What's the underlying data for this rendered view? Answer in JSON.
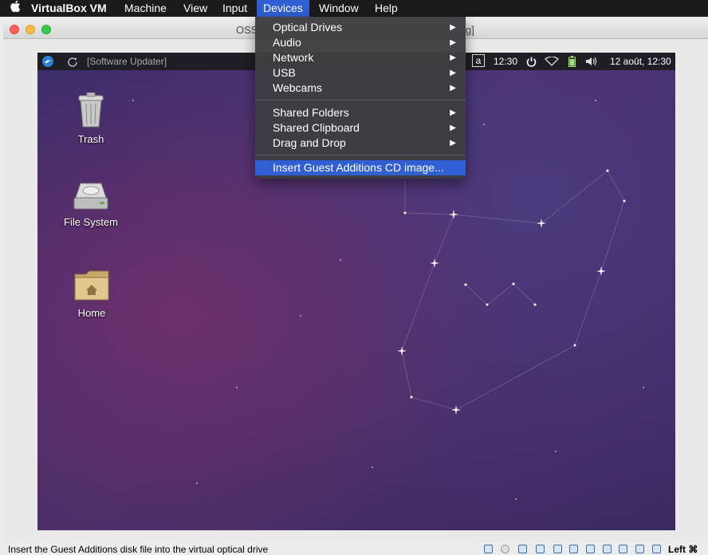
{
  "menubar": {
    "apple_icon": "apple-icon",
    "app_name": "VirtualBox VM",
    "items": [
      "Machine",
      "View",
      "Input",
      "Devices",
      "Window",
      "Help"
    ]
  },
  "window": {
    "title_left": "OSS",
    "title_right": "g]"
  },
  "guest": {
    "panel": {
      "task": "[Software Updater]",
      "keyboard": "a",
      "time": "12:30",
      "datetime": "12 août, 12:30"
    },
    "desktop_icons": [
      {
        "label": "Trash"
      },
      {
        "label": "File System"
      },
      {
        "label": "Home"
      }
    ]
  },
  "devices_menu": {
    "items": [
      {
        "label": "Optical Drives"
      },
      {
        "label": "Audio"
      },
      {
        "label": "Network"
      },
      {
        "label": "USB"
      },
      {
        "label": "Webcams"
      },
      {
        "label": "Shared Folders"
      },
      {
        "label": "Shared Clipboard"
      },
      {
        "label": "Drag and Drop"
      },
      {
        "label": "Insert Guest Additions CD image..."
      }
    ]
  },
  "statusbar": {
    "text": "Insert the Guest Additions disk file into the virtual optical drive",
    "host_key": "Left ⌘"
  },
  "colors": {
    "menu_highlight": "#2f5fd2",
    "menubar_bg": "#1b1b1d",
    "guest_panel_bg": "#1e1e24"
  }
}
